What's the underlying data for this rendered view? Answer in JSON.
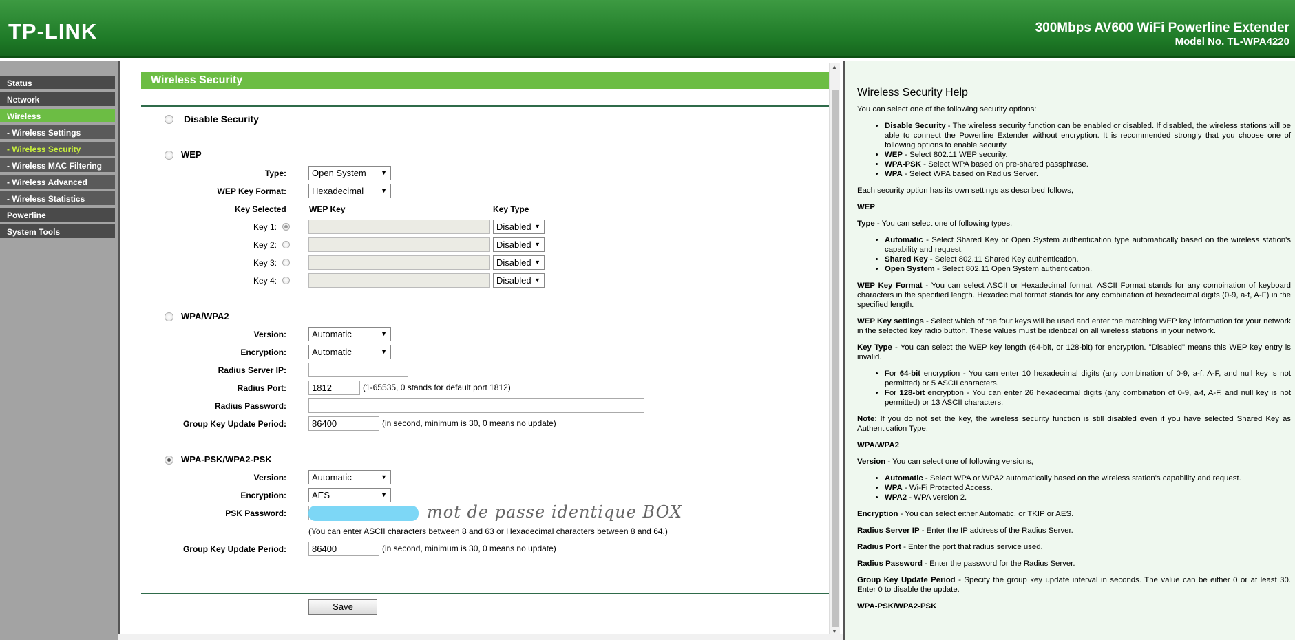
{
  "header": {
    "logo": "TP-LINK",
    "product": "300Mbps AV600 WiFi Powerline Extender",
    "model": "Model No. TL-WPA4220"
  },
  "sidebar": {
    "items": [
      {
        "label": "Status",
        "type": "top",
        "active": false
      },
      {
        "label": "Network",
        "type": "top",
        "active": false
      },
      {
        "label": "Wireless",
        "type": "top",
        "active": true
      },
      {
        "label": "- Wireless Settings",
        "type": "sub",
        "active": false
      },
      {
        "label": "- Wireless Security",
        "type": "sub",
        "active": true
      },
      {
        "label": "- Wireless MAC Filtering",
        "type": "sub",
        "active": false
      },
      {
        "label": "- Wireless Advanced",
        "type": "sub",
        "active": false
      },
      {
        "label": "- Wireless Statistics",
        "type": "sub",
        "active": false
      },
      {
        "label": "Powerline",
        "type": "top",
        "active": false
      },
      {
        "label": "System Tools",
        "type": "top",
        "active": false
      }
    ]
  },
  "main": {
    "title": "Wireless Security",
    "disable": {
      "label": "Disable Security",
      "checked": false
    },
    "wep": {
      "label": "WEP",
      "checked": false,
      "type_label": "Type:",
      "type_value": "Open System",
      "format_label": "WEP Key Format:",
      "format_value": "Hexadecimal",
      "col_key_selected": "Key Selected",
      "col_wep_key": "WEP Key",
      "col_key_type": "Key Type",
      "keys": [
        {
          "label": "Key 1:",
          "type": "Disabled"
        },
        {
          "label": "Key 2:",
          "type": "Disabled"
        },
        {
          "label": "Key 3:",
          "type": "Disabled"
        },
        {
          "label": "Key 4:",
          "type": "Disabled"
        }
      ]
    },
    "wpa": {
      "label": "WPA/WPA2",
      "checked": false,
      "version_label": "Version:",
      "version_value": "Automatic",
      "encryption_label": "Encryption:",
      "encryption_value": "Automatic",
      "radius_ip_label": "Radius Server IP:",
      "radius_ip_value": "",
      "radius_port_label": "Radius Port:",
      "radius_port_value": "1812",
      "radius_port_hint": "(1-65535, 0 stands for default port 1812)",
      "radius_pw_label": "Radius Password:",
      "radius_pw_value": "",
      "gkup_label": "Group Key Update Period:",
      "gkup_value": "86400",
      "gkup_hint": "(in second, minimum is 30, 0 means no update)"
    },
    "psk": {
      "label": "WPA-PSK/WPA2-PSK",
      "checked": true,
      "version_label": "Version:",
      "version_value": "Automatic",
      "encryption_label": "Encryption:",
      "encryption_value": "AES",
      "pw_label": "PSK Password:",
      "pw_overlay": "mot de passe identique BOX",
      "pw_hint": "(You can enter ASCII characters between 8 and 63 or Hexadecimal characters between 8 and 64.)",
      "gkup_label": "Group Key Update Period:",
      "gkup_value": "86400",
      "gkup_hint": "(in second, minimum is 30, 0 means no update)"
    },
    "save_label": "Save"
  },
  "help": {
    "title": "Wireless Security Help",
    "intro": "You can select one of the following security options:",
    "opts": [
      {
        "b": "Disable Security",
        "t": " - The wireless security function can be enabled or disabled. If disabled, the wireless stations will be able to connect the Powerline Extender without encryption. It is recommended strongly that you choose one of following options to enable security."
      },
      {
        "b": "WEP",
        "t": " - Select 802.11 WEP security."
      },
      {
        "b": "WPA-PSK",
        "t": " - Select WPA based on pre-shared passphrase."
      },
      {
        "b": "WPA",
        "t": " - Select WPA based on Radius Server."
      }
    ],
    "each": "Each security option has its own settings as described  follows,",
    "wep_h": "WEP",
    "type_b": "Type",
    "type_t": " - You can select one of following types,",
    "types": [
      {
        "b": "Automatic",
        "t": " - Select Shared Key or Open System authentication type automatically based on the wireless station's capability and request."
      },
      {
        "b": "Shared Key",
        "t": " - Select 802.11 Shared Key authentication."
      },
      {
        "b": "Open System",
        "t": " - Select 802.11 Open System authentication."
      }
    ],
    "fmt_b": "WEP Key Format",
    "fmt_t": " - You can select ASCII or Hexadecimal format. ASCII Format stands for any combination of keyboard characters in the specified length. Hexadecimal format stands for any combination of hexadecimal digits (0-9, a-f, A-F) in the specified length.",
    "set_b": "WEP Key settings",
    "set_t": " - Select which of the four keys will be used and enter the matching WEP key information for your network in the selected key radio button. These values must be identical on all wireless stations in your network.",
    "kt_b": "Key Type",
    "kt_t": " - You can select the WEP key length (64-bit, or 128-bit) for encryption. \"Disabled\" means this WEP key entry is invalid.",
    "bits": [
      {
        "pre": "For ",
        "b": "64-bit",
        "t": " encryption - You can enter 10 hexadecimal digits (any combination of 0-9, a-f, A-F, and null key is not permitted) or 5 ASCII characters."
      },
      {
        "pre": "For ",
        "b": "128-bit",
        "t": " encryption - You can enter 26 hexadecimal digits (any combination of 0-9, a-f, A-F, and null key is not permitted) or 13 ASCII characters."
      }
    ],
    "note_b": "Note",
    "note_t": ": If you do not set the key, the wireless security function is still disabled even if you have selected Shared Key as Authentication Type.",
    "wpa_h": "WPA/WPA2",
    "ver_b": "Version",
    "ver_t": " -  You can select one of following versions,",
    "vers": [
      {
        "b": "Automatic",
        "t": " - Select WPA or WPA2 automatically based on the wireless station's capability and request."
      },
      {
        "b": "WPA",
        "t": " - Wi-Fi Protected Access."
      },
      {
        "b": "WPA2",
        "t": " - WPA version 2."
      }
    ],
    "enc_b": "Encryption",
    "enc_t": " - You can select either Automatic, or TKIP or AES.",
    "rip_b": "Radius Server IP",
    "rip_t": " - Enter the IP address of the Radius Server.",
    "rport_b": "Radius Port",
    "rport_t": " - Enter the port that radius service used.",
    "rpw_b": "Radius Password",
    "rpw_t": " - Enter the password for the Radius Server.",
    "gk_b": "Group Key Update Period",
    "gk_t": " - Specify the group key update interval in seconds. The value can be either 0 or at least 30. Enter 0 to disable the update.",
    "psk_h": "WPA-PSK/WPA2-PSK"
  }
}
